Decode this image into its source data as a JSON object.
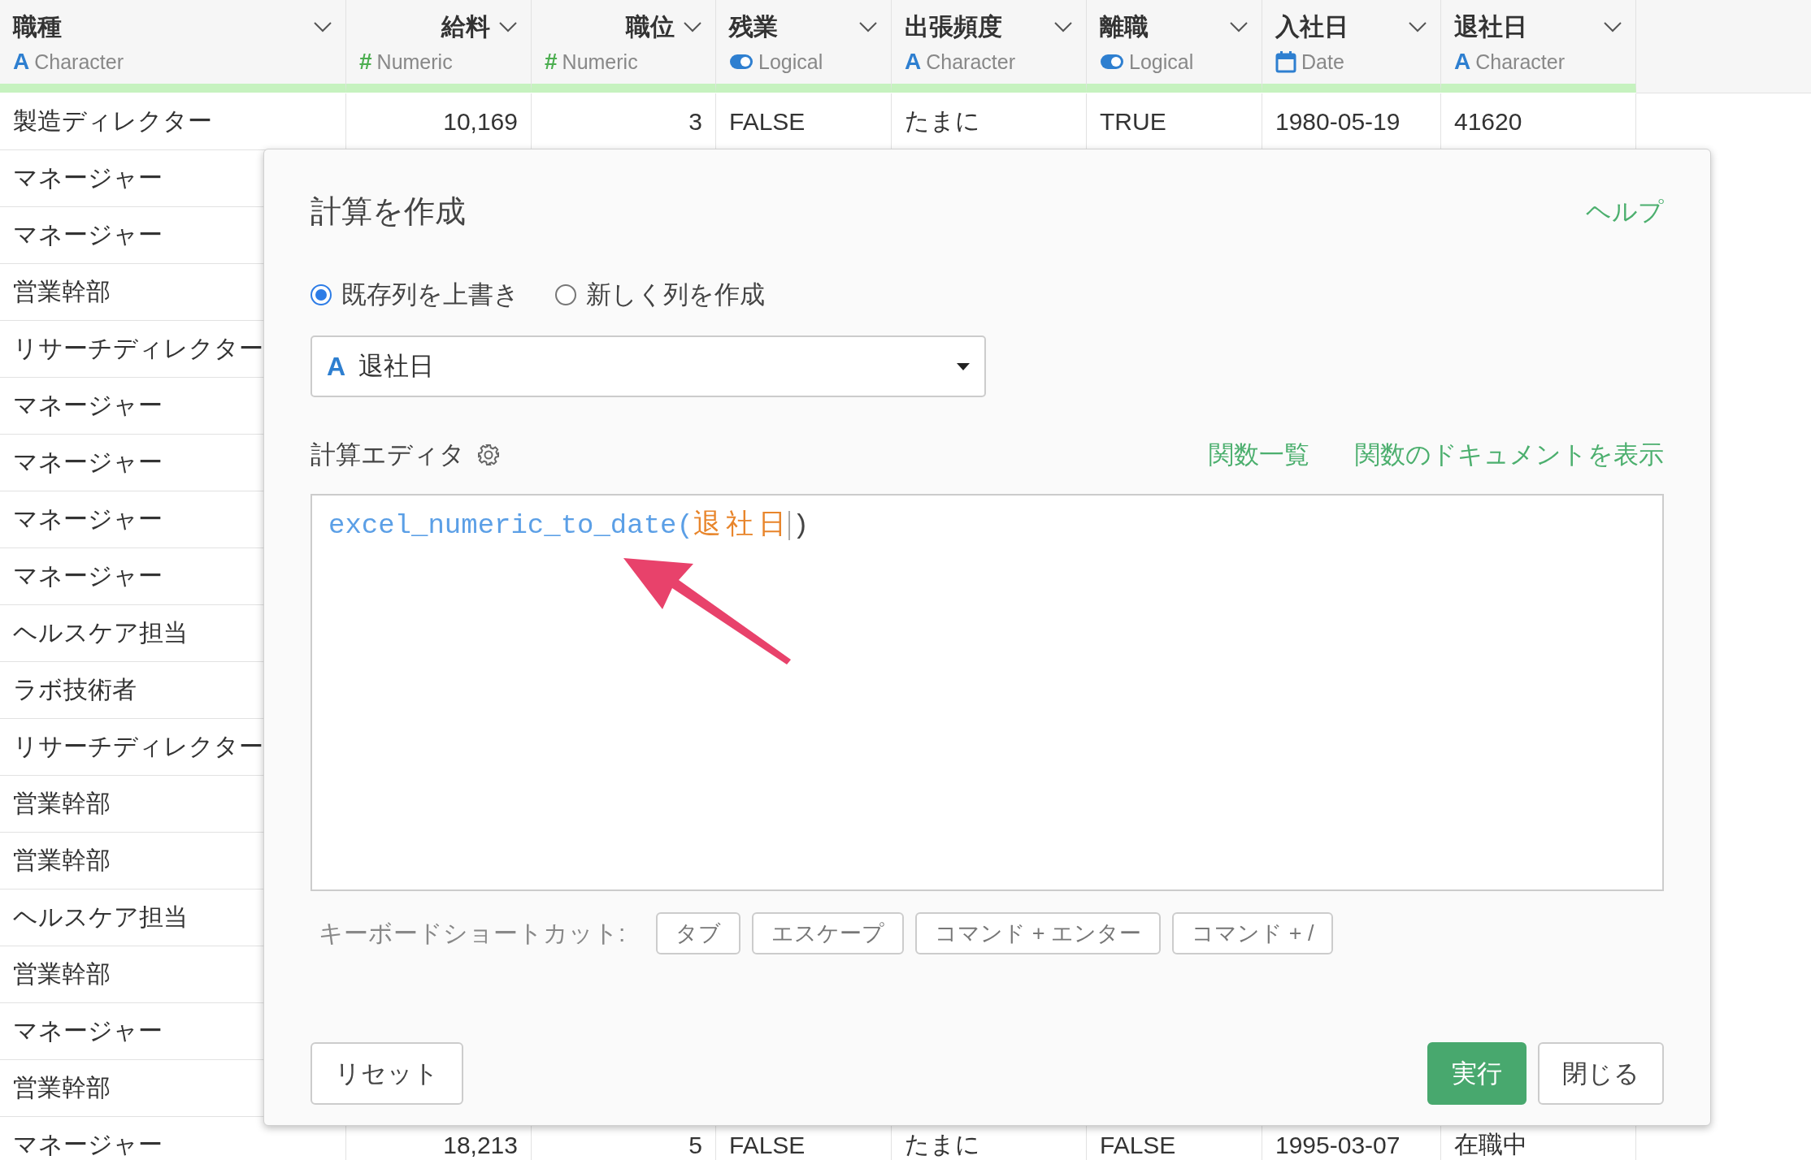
{
  "table": {
    "columns": [
      {
        "name": "職種",
        "type": "Character",
        "icon": "A"
      },
      {
        "name": "給料",
        "type": "Numeric",
        "icon": "#"
      },
      {
        "name": "職位",
        "type": "Numeric",
        "icon": "#"
      },
      {
        "name": "残業",
        "type": "Logical"
      },
      {
        "name": "出張頻度",
        "type": "Character",
        "icon": "A"
      },
      {
        "name": "離職",
        "type": "Logical"
      },
      {
        "name": "入社日",
        "type": "Date"
      },
      {
        "name": "退社日",
        "type": "Character",
        "icon": "A"
      }
    ],
    "rows": [
      {
        "cells": [
          "製造ディレクター",
          "10,169",
          "3",
          "FALSE",
          "たまに",
          "TRUE",
          "1980-05-19",
          "41620"
        ]
      },
      {
        "cells": [
          "マネージャー"
        ]
      },
      {
        "cells": [
          "マネージャー"
        ]
      },
      {
        "cells": [
          "営業幹部"
        ]
      },
      {
        "cells": [
          "リサーチディレクター"
        ]
      },
      {
        "cells": [
          "マネージャー"
        ]
      },
      {
        "cells": [
          "マネージャー"
        ]
      },
      {
        "cells": [
          "マネージャー"
        ]
      },
      {
        "cells": [
          "マネージャー"
        ]
      },
      {
        "cells": [
          "ヘルスケア担当"
        ]
      },
      {
        "cells": [
          "ラボ技術者"
        ]
      },
      {
        "cells": [
          "リサーチディレクター"
        ]
      },
      {
        "cells": [
          "営業幹部"
        ]
      },
      {
        "cells": [
          "営業幹部"
        ]
      },
      {
        "cells": [
          "ヘルスケア担当"
        ]
      },
      {
        "cells": [
          "営業幹部"
        ]
      },
      {
        "cells": [
          "マネージャー"
        ]
      },
      {
        "cells": [
          "営業幹部"
        ]
      },
      {
        "cells": [
          "マネージャー",
          "18,213",
          "5",
          "FALSE",
          "たまに",
          "FALSE",
          "1995-03-07",
          "在職中"
        ]
      }
    ]
  },
  "dialog": {
    "title": "計算を作成",
    "help_link": "ヘルプ",
    "modes": [
      {
        "label": "既存列を上書き",
        "selected": true
      },
      {
        "label": "新しく列を作成",
        "selected": false
      }
    ],
    "column_select": {
      "icon": "A",
      "value": "退社日"
    },
    "editor": {
      "label": "計算エディタ",
      "links": [
        "関数一覧",
        "関数のドキュメントを表示"
      ],
      "code": {
        "function": "excel_numeric_to_date(",
        "argument": "退社日",
        "close": ")"
      }
    },
    "shortcuts": {
      "label": "キーボードショートカット:",
      "keys": [
        "タブ",
        "エスケープ",
        "コマンド + エンター",
        "コマンド + /"
      ]
    },
    "buttons": [
      {
        "label": "リセット",
        "kind": "secondary"
      },
      {
        "label": "実行",
        "kind": "primary"
      },
      {
        "label": "閉じる",
        "kind": "secondary"
      }
    ]
  }
}
